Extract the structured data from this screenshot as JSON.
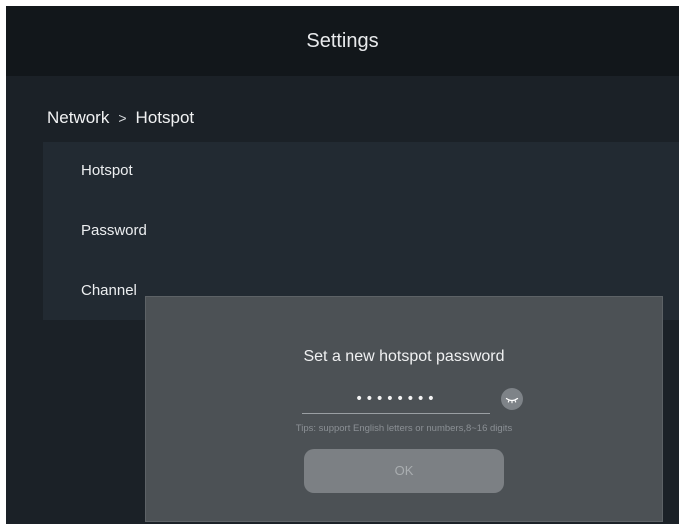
{
  "header": {
    "title": "Settings"
  },
  "breadcrumb": {
    "parent": "Network",
    "separator": ">",
    "current": "Hotspot"
  },
  "settings": {
    "items": [
      {
        "label": "Hotspot"
      },
      {
        "label": "Password"
      },
      {
        "label": "Channel"
      }
    ]
  },
  "dialog": {
    "title": "Set a new hotspot password",
    "password_masked": "••••••••",
    "visibility_icon": "eye-closed-icon",
    "tips": "Tips: support English letters or numbers,8~16 digits",
    "ok_label": "OK"
  },
  "colors": {
    "background": "#1b2127",
    "header": "#12171b",
    "dialog": "#4c5155",
    "button_disabled": "#7c8084"
  }
}
